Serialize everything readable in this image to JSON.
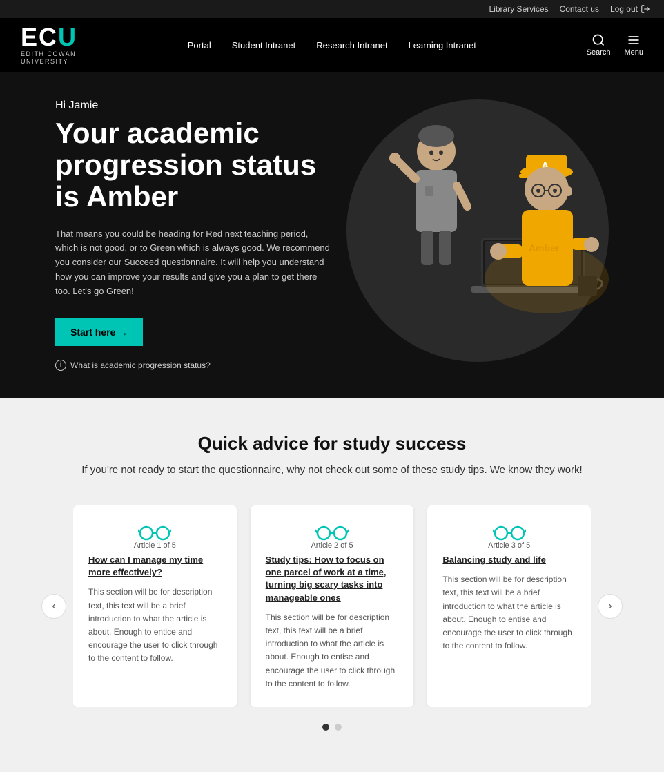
{
  "utility": {
    "library": "Library Services",
    "contact": "Contact us",
    "logout": "Log out"
  },
  "header": {
    "logo_ecu": "ECU",
    "logo_u_color": "U",
    "logo_sub1": "EDITH COWAN",
    "logo_sub2": "UNIVERSITY",
    "nav": {
      "portal": "Portal",
      "student": "Student Intranet",
      "research": "Research Intranet",
      "learning": "Learning Intranet"
    },
    "search_label": "Search",
    "menu_label": "Menu"
  },
  "hero": {
    "greeting": "Hi Jamie",
    "title": "Your academic progression status is Amber",
    "body": "That means you could be heading for Red next teaching period, which is not good, or to Green which is always good. We recommend you consider our Succeed questionnaire. It will help you understand how you can improve your results and give you a plan to get there too. Let's go Green!",
    "cta_label": "Start here →",
    "info_link": "What is academic progression status?"
  },
  "advice": {
    "title": "Quick advice for study success",
    "subtitle": "If you're not ready to start the questionnaire, why not check out\nsome of these study tips. We know they work!",
    "cards": [
      {
        "article_label": "Article 1 of 5",
        "title": "How can I manage my time more effectively?",
        "body": "This section will be for description text, this text will be a brief introduction to what the article is about. Enough to entice and encourage the user to click through to the content to follow."
      },
      {
        "article_label": "Article 2 of 5",
        "title": "Study tips: How to focus on one parcel of work at a time, turning big scary tasks into manageable ones",
        "body": "This section will be for description text, this text will be a brief introduction to what the article is about. Enough to entise and encourage the user to click through to the content to follow."
      },
      {
        "article_label": "Article 3 of 5",
        "title": "Balancing study and life",
        "body": "This section will be for description text, this text will be a brief introduction to what the article is about. Enough to entise and encourage the user to click through to the content to follow."
      }
    ],
    "prev_label": "‹",
    "next_label": "›",
    "dots": [
      {
        "active": true
      },
      {
        "active": false
      }
    ]
  }
}
